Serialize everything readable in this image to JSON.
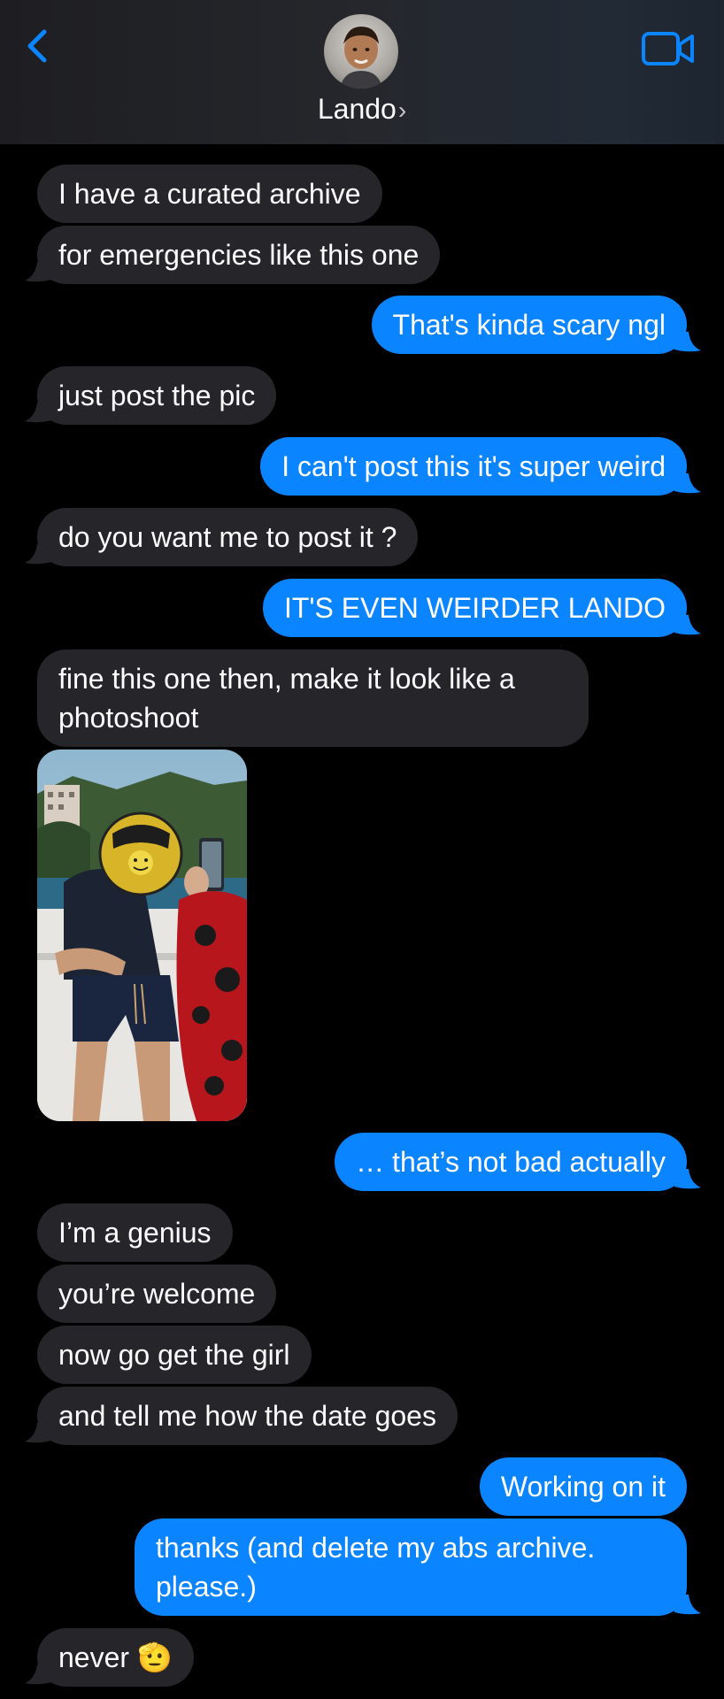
{
  "header": {
    "contact_name": "Lando",
    "chevron": "›",
    "icons": {
      "back": "chevron-left-icon",
      "video": "video-camera-icon"
    },
    "accent_color": "#0a84ff"
  },
  "messages": [
    {
      "from": "contact",
      "text": "I have a curated archive"
    },
    {
      "from": "contact",
      "text": "for emergencies like this one"
    },
    {
      "from": "me",
      "text": "That's kinda scary ngl"
    },
    {
      "from": "contact",
      "text": "just post the pic"
    },
    {
      "from": "me",
      "text": "I can't post this it's super weird"
    },
    {
      "from": "contact",
      "text": "do you want me to post it ?"
    },
    {
      "from": "me",
      "text": "IT'S EVEN WEIRDER LANDO"
    },
    {
      "from": "contact",
      "text": "fine this one then, make it look like a photoshoot"
    },
    {
      "from": "contact",
      "type": "image",
      "description": "photo attachment"
    },
    {
      "from": "me",
      "text": "… that’s not bad actually"
    },
    {
      "from": "contact",
      "text": "I’m a genius"
    },
    {
      "from": "contact",
      "text": "you’re welcome"
    },
    {
      "from": "contact",
      "text": "now go get the girl"
    },
    {
      "from": "contact",
      "text": "and tell me how the date goes"
    },
    {
      "from": "me",
      "text": "Working on it"
    },
    {
      "from": "me",
      "text": "thanks (and delete my abs archive. please.)"
    },
    {
      "from": "contact",
      "text": "never 🫡"
    }
  ],
  "colors": {
    "incoming_bubble": "#26252a",
    "outgoing_bubble": "#0a84ff",
    "background": "#000000"
  }
}
